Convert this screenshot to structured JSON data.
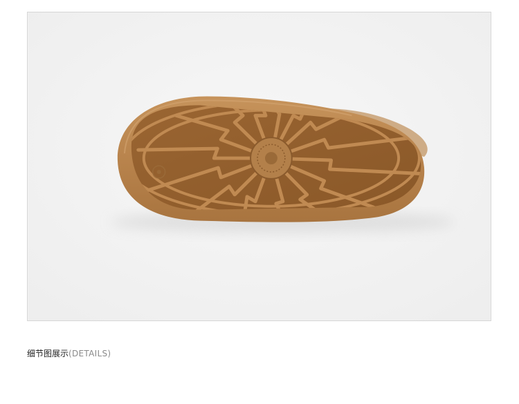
{
  "caption": {
    "title": "细节图展示",
    "subtitle": "(DETAILS)"
  },
  "colors": {
    "background": "#f4f4f4",
    "sole_base": "#b8834d",
    "sole_tread": "#8a5a2c",
    "frame_border": "#d6d6d6"
  },
  "image": {
    "subject": "shoe-sole-photo"
  }
}
